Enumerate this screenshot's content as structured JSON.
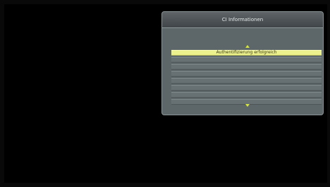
{
  "dialog": {
    "title": "CI Informationen",
    "items": [
      {
        "label": "Authentifizierung erfolgreich",
        "selected": true
      },
      {
        "label": "",
        "selected": false
      },
      {
        "label": "",
        "selected": false
      },
      {
        "label": "",
        "selected": false
      },
      {
        "label": "",
        "selected": false
      },
      {
        "label": "",
        "selected": false
      },
      {
        "label": "",
        "selected": false
      },
      {
        "label": "",
        "selected": false
      }
    ],
    "scroll_up_icon": "triangle-up-icon",
    "scroll_down_icon": "triangle-down-icon"
  },
  "colors": {
    "screen_background": "#000000",
    "dialog_background": "#5d6668",
    "selected_row": "#ecf18d",
    "scroll_arrows": "#d6e63c",
    "title_text": "#e6eaea"
  }
}
